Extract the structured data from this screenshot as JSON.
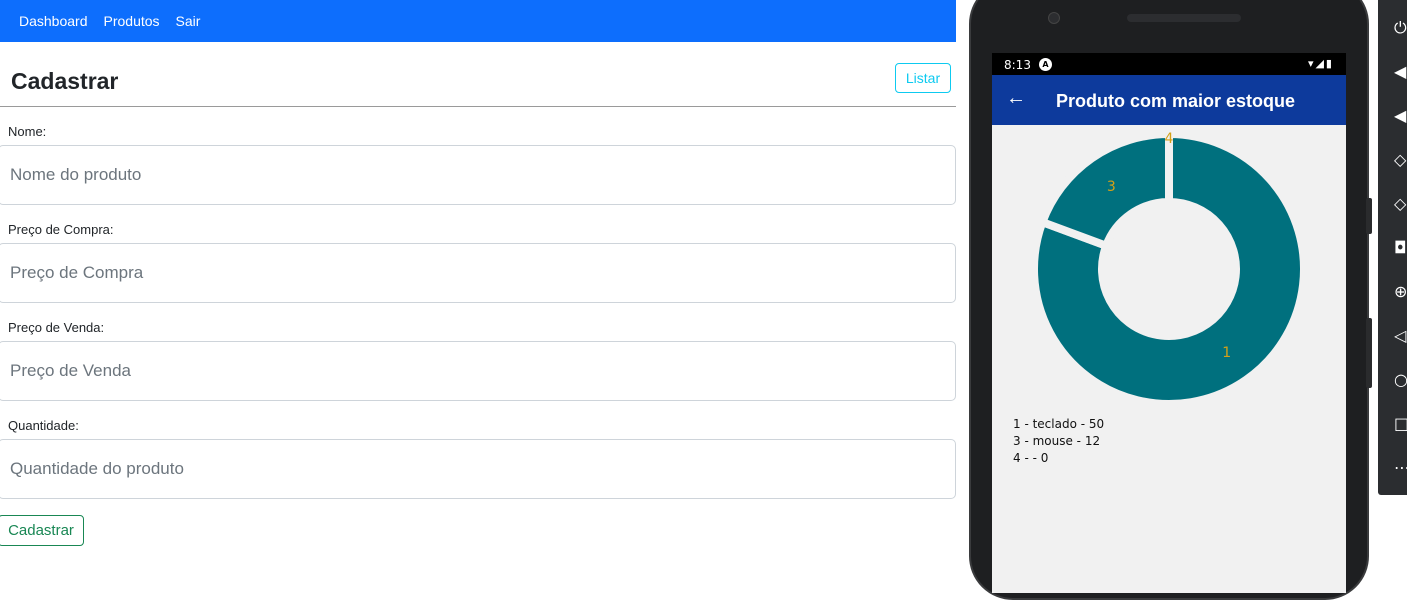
{
  "web": {
    "nav": [
      "Dashboard",
      "Produtos",
      "Sair"
    ],
    "title": "Cadastrar",
    "list_button": "Listar",
    "fields": [
      {
        "label": "Nome:",
        "placeholder": "Nome do produto"
      },
      {
        "label": "Preço de Compra:",
        "placeholder": "Preço de Compra"
      },
      {
        "label": "Preço de Venda:",
        "placeholder": "Preço de Venda"
      },
      {
        "label": "Quantidade:",
        "placeholder": "Quantidade do produto"
      }
    ],
    "submit_button": "Cadastrar",
    "colors": {
      "navbar": "#0d6efd",
      "listar": "#0dcaf0",
      "submit": "#198754"
    }
  },
  "phone": {
    "status_time": "8:13",
    "appbar_title": "Produto com maior estoque",
    "back_icon": "arrow-left-icon",
    "legend": [
      "1 - teclado - 50",
      "3 - mouse - 12",
      "4 -  - 0"
    ],
    "colors": {
      "appbar": "#0d3a9c",
      "slice": "#00707e",
      "label": "#d4a017"
    }
  },
  "chart_data": {
    "type": "pie",
    "categories": [
      "1",
      "3",
      "4"
    ],
    "values": [
      50,
      12,
      0
    ],
    "legend": [
      "1 - teclado - 50",
      "3 - mouse - 12",
      "4 -  - 0"
    ],
    "title": "",
    "legend_position": "bottom-left"
  },
  "emulator_toolbar": [
    "power-icon",
    "volume-up-icon",
    "volume-down-icon",
    "rotate-left-icon",
    "rotate-right-icon",
    "camera-icon",
    "zoom-icon",
    "back-icon",
    "home-icon",
    "overview-icon",
    "more-icon"
  ]
}
